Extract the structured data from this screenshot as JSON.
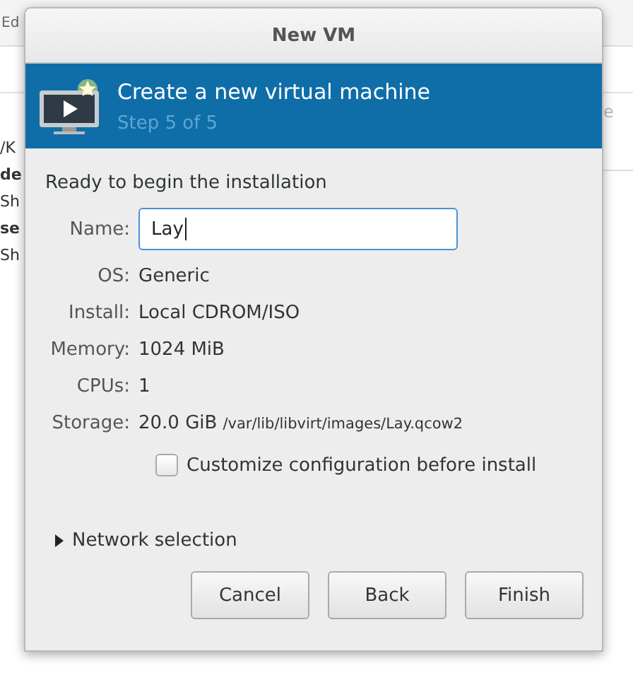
{
  "background_window": {
    "menu": "Ed",
    "left_fragments": [
      "/K",
      "de",
      "Sh",
      "se",
      "Sh"
    ],
    "right_fragments": [
      "e"
    ]
  },
  "dialog": {
    "title": "New VM",
    "header": {
      "title": "Create a new virtual machine",
      "subtitle": "Step 5 of 5"
    },
    "heading": "Ready to begin the installation",
    "name_field": {
      "label": "Name:",
      "value": "Lay"
    },
    "details": [
      {
        "label": "OS:",
        "value": "Generic"
      },
      {
        "label": "Install:",
        "value": "Local CDROM/ISO"
      },
      {
        "label": "Memory:",
        "value": "1024 MiB"
      },
      {
        "label": "CPUs:",
        "value": "1"
      },
      {
        "label": "Storage:",
        "value": "20.0 GiB",
        "path": "/var/lib/libvirt/images/Lay.qcow2"
      }
    ],
    "customize_checkbox": {
      "label": "Customize configuration before install",
      "checked": false
    },
    "network_expander": {
      "label": "Network selection",
      "expanded": false
    },
    "buttons": [
      "Cancel",
      "Back",
      "Finish"
    ]
  }
}
